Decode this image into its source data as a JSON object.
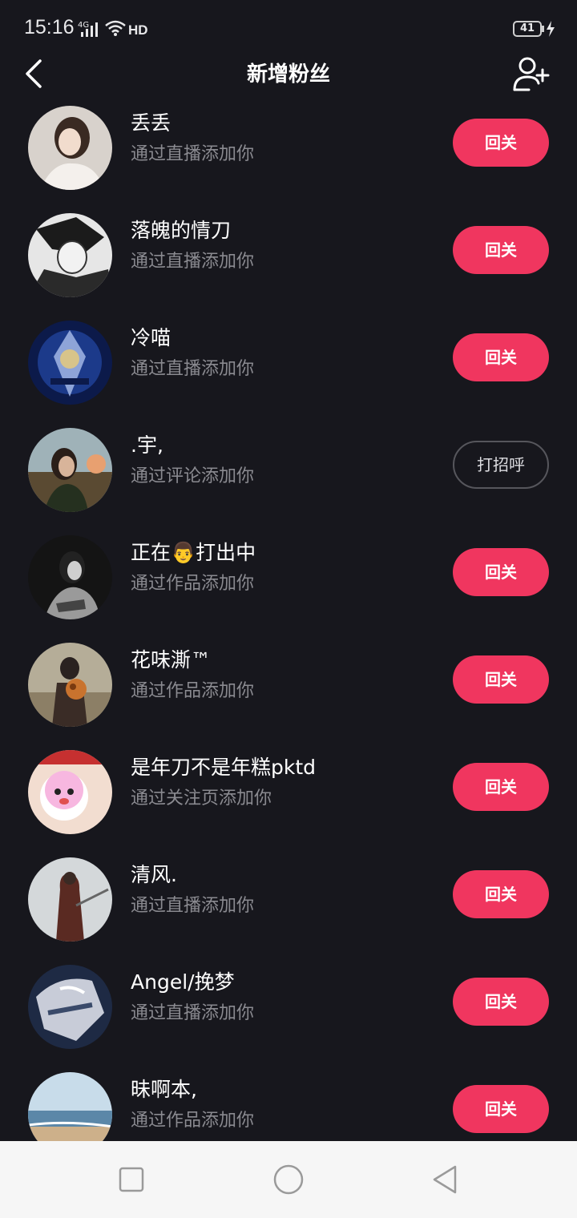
{
  "status_bar": {
    "time": "15:16",
    "network": "4G",
    "hd": "HD",
    "battery": "41"
  },
  "header": {
    "title": "新增粉丝",
    "back_icon": "chevron-left-icon",
    "add_icon": "add-user-icon"
  },
  "colors": {
    "background": "#17171d",
    "accent": "#f0365f",
    "secondary_text": "#8a8a90"
  },
  "fans": [
    {
      "name": "丢丢",
      "source": "通过直播添加你",
      "action": "回关",
      "type": "follow"
    },
    {
      "name": "落魄的情刀",
      "source": "通过直播添加你",
      "action": "回关",
      "type": "follow"
    },
    {
      "name": "冷喵",
      "source": "通过直播添加你",
      "action": "回关",
      "type": "follow"
    },
    {
      "name": ".宇,",
      "source": "通过评论添加你",
      "action": "打招呼",
      "type": "greet"
    },
    {
      "name": "正在👨打出中",
      "source": "通过作品添加你",
      "action": "回关",
      "type": "follow"
    },
    {
      "name": "花味澌™",
      "source": "通过作品添加你",
      "action": "回关",
      "type": "follow"
    },
    {
      "name": "是年刀不是年糕pktd",
      "source": "通过关注页添加你",
      "action": "回关",
      "type": "follow"
    },
    {
      "name": "清风.",
      "source": "通过直播添加你",
      "action": "回关",
      "type": "follow"
    },
    {
      "name": "Angel/挽梦",
      "source": "通过直播添加你",
      "action": "回关",
      "type": "follow"
    },
    {
      "name": "昧啊本,",
      "source": "通过作品添加你",
      "action": "回关",
      "type": "follow"
    }
  ],
  "nav_bar": {
    "icons": [
      "square-recents-icon",
      "circle-home-icon",
      "triangle-back-icon"
    ]
  }
}
